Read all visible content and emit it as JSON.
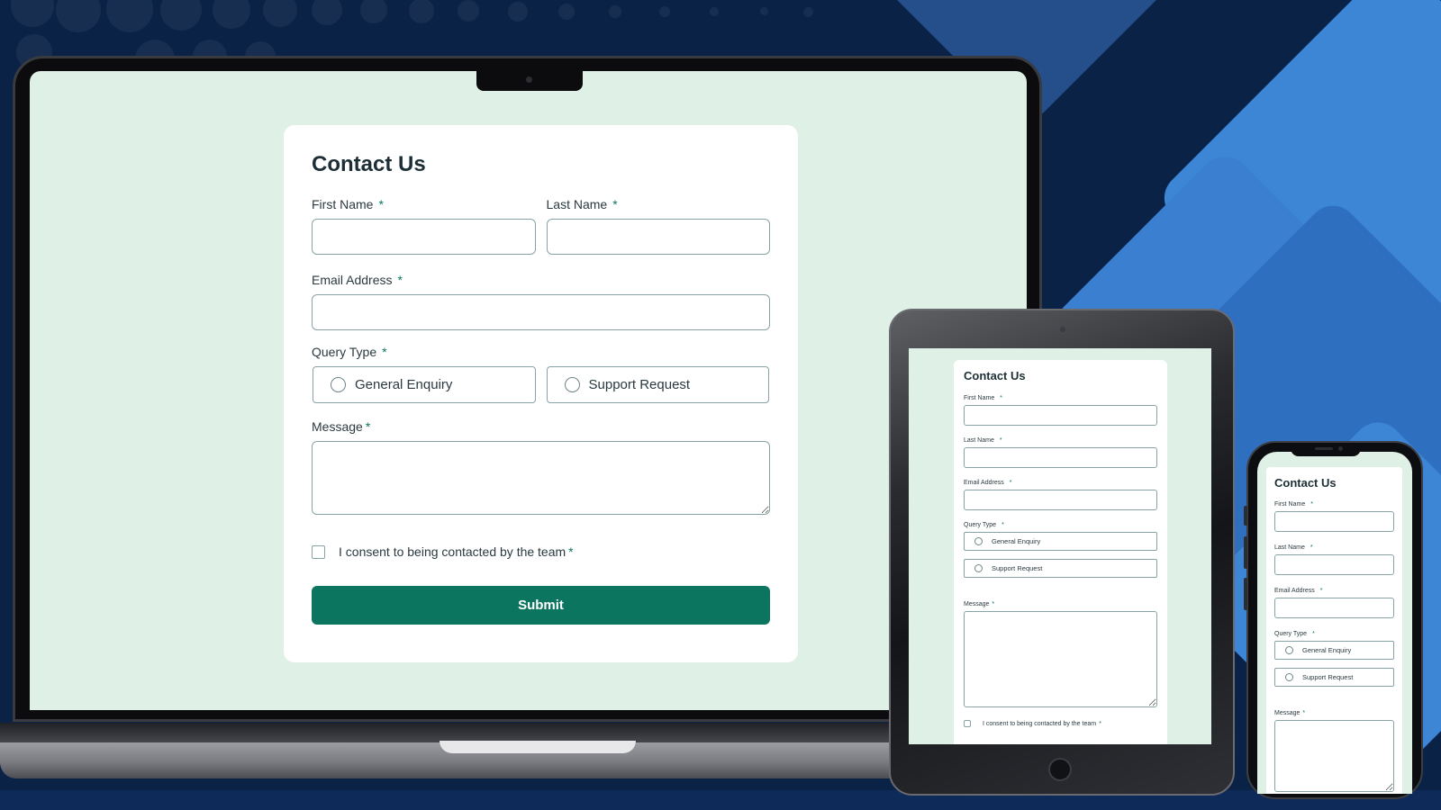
{
  "form": {
    "title": "Contact Us",
    "first_name_label": "First Name",
    "last_name_label": "Last Name",
    "email_label": "Email Address",
    "query_type_label": "Query Type",
    "query_options": [
      "General Enquiry",
      "Support Request"
    ],
    "message_label": "Message",
    "required_mark": "*",
    "consent_label": "I consent to being contacted by the team",
    "submit_label": "Submit"
  },
  "colors": {
    "background": "#0b2247",
    "screen_bg": "#dff0e6",
    "accent": "#0c7560",
    "accent_decor": "#3d86d6"
  },
  "devices": [
    "laptop",
    "tablet",
    "phone"
  ]
}
